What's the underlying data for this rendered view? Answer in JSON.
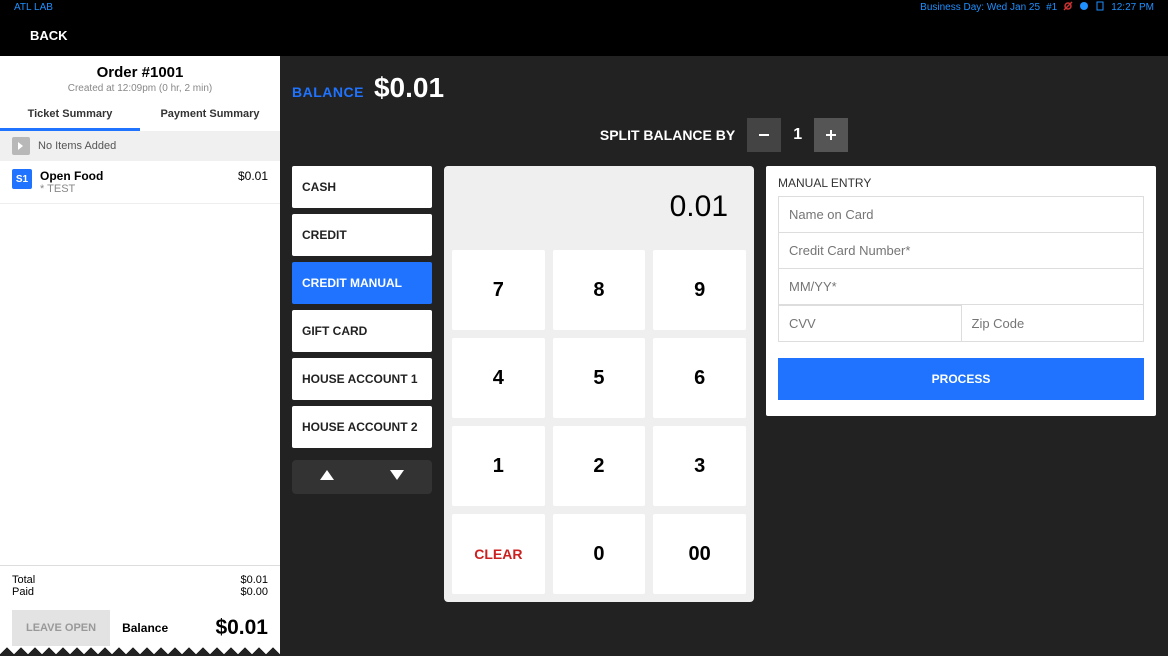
{
  "statusbar": {
    "left": "ATL LAB",
    "business_day": "Business Day: Wed Jan 25",
    "display_num": "#1",
    "clock": "12:27 PM"
  },
  "back": {
    "label": "BACK"
  },
  "order": {
    "title": "Order #1001",
    "subtitle": "Created at 12:09pm (0 hr, 2 min)",
    "tabs": {
      "ticket": "Ticket Summary",
      "payment": "Payment Summary"
    },
    "no_items": "No Items Added",
    "line_item": {
      "seat": "S1",
      "name": "Open Food",
      "mod": "* TEST",
      "price": "$0.01"
    },
    "totals": {
      "total_label": "Total",
      "total_value": "$0.01",
      "paid_label": "Paid",
      "paid_value": "$0.00"
    },
    "leave_open": "LEAVE OPEN",
    "balance_label": "Balance",
    "balance_amount": "$0.01"
  },
  "balance_head": {
    "label": "BALANCE",
    "amount": "$0.01"
  },
  "split": {
    "label": "SPLIT BALANCE BY",
    "count": "1"
  },
  "pay_types": {
    "cash": "CASH",
    "credit": "CREDIT",
    "credit_manual": "CREDIT MANUAL",
    "gift": "GIFT CARD",
    "house1": "HOUSE ACCOUNT 1",
    "house2": "HOUSE ACCOUNT 2"
  },
  "keypad": {
    "display": "0.01",
    "keys": {
      "7": "7",
      "8": "8",
      "9": "9",
      "4": "4",
      "5": "5",
      "6": "6",
      "1": "1",
      "2": "2",
      "3": "3",
      "clear": "CLEAR",
      "0": "0",
      "00": "00"
    }
  },
  "manual": {
    "title": "MANUAL ENTRY",
    "placeholders": {
      "name": "Name on Card",
      "card": "Credit Card Number*",
      "exp": "MM/YY*",
      "cvv": "CVV",
      "zip": "Zip Code"
    },
    "process": "PROCESS"
  }
}
